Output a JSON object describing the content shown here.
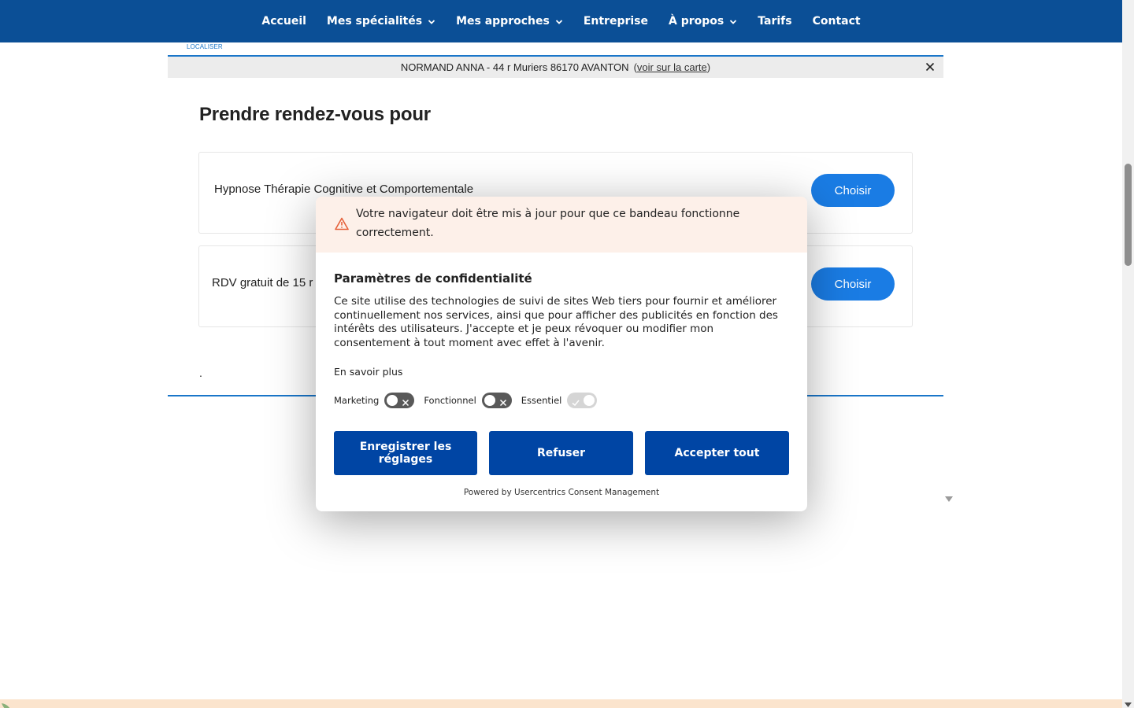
{
  "nav": {
    "items": [
      {
        "label": "Accueil",
        "dropdown": false
      },
      {
        "label": "Mes spécialités",
        "dropdown": true
      },
      {
        "label": "Mes approches",
        "dropdown": true
      },
      {
        "label": "Entreprise",
        "dropdown": false
      },
      {
        "label": "À propos",
        "dropdown": true
      },
      {
        "label": "Tarifs",
        "dropdown": false
      },
      {
        "label": "Contact",
        "dropdown": false
      }
    ]
  },
  "header": {
    "logo_link": "LOCALISER"
  },
  "address_bar": {
    "text": "NORMAND ANNA - 44 r Muriers 86170 AVANTON",
    "map_link_open": "(",
    "map_link": "voir sur la carte",
    "map_link_close": ")"
  },
  "booking": {
    "title": "Prendre rendez-vous pour",
    "services": [
      {
        "name": "Hypnose Thérapie Cognitive et Comportementale",
        "button": "Choisir"
      },
      {
        "name": "RDV gratuit de 15 r",
        "button": "Choisir"
      }
    ],
    "footnote": "."
  },
  "consent": {
    "warning": "Votre navigateur doit être mis à jour pour que ce bandeau fonctionne correctement.",
    "title": "Paramètres de confidentialité",
    "description": "Ce site utilise des technologies de suivi de sites Web tiers pour fournir et améliorer continuellement nos services, ainsi que pour afficher des publicités en fonction des intérêts des utilisateurs. J'accepte et je peux révoquer ou modifier mon consentement à tout moment avec effet à l'avenir.",
    "learn_more": "En savoir plus",
    "toggles": [
      {
        "label": "Marketing",
        "state": "off"
      },
      {
        "label": "Fonctionnel",
        "state": "off"
      },
      {
        "label": "Essentiel",
        "state": "on-locked"
      }
    ],
    "buttons": {
      "save": "Enregistrer les réglages",
      "deny": "Refuser",
      "accept": "Accepter tout"
    },
    "powered_by": "Powered by Usercentrics Consent Management"
  },
  "colors": {
    "nav_bg": "#0b4f96",
    "accent_blue": "#1a7ce4",
    "consent_button": "#0045a4",
    "warning_bg": "#fdf0e9",
    "warning_icon": "#e5603a"
  }
}
